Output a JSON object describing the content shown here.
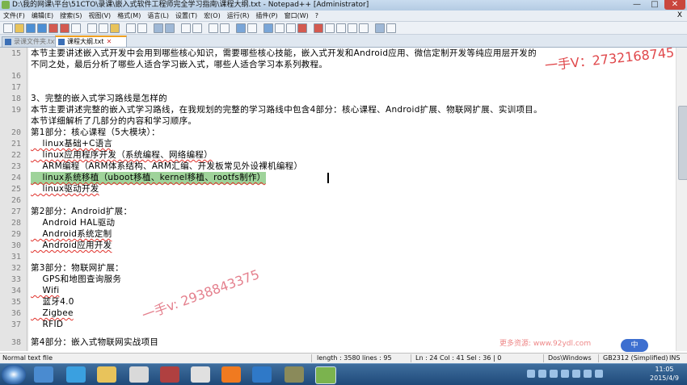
{
  "window": {
    "title": "D:\\我的网课\\平台\\51CTO\\录课\\嵌入式软件工程师完全学习指南\\课程大纲.txt - Notepad++ [Administrator]",
    "minimize_glyph": "—",
    "maximize_glyph": "□",
    "close_glyph": "✕"
  },
  "menu": [
    "文件(F)",
    "编辑(E)",
    "搜索(S)",
    "视图(V)",
    "格式(M)",
    "语言(L)",
    "设置(T)",
    "宏(O)",
    "运行(R)",
    "插件(P)",
    "窗口(W)",
    "?"
  ],
  "menu_close": "X",
  "tabs": [
    {
      "label": "录课文件夹.txt",
      "close": "✕",
      "active": false
    },
    {
      "label": "课程大纲.txt",
      "close": "✕",
      "active": true
    }
  ],
  "editor": {
    "lines": [
      {
        "n": "15",
        "text": "本节主要讲述嵌入式开发中会用到哪些核心知识，需要哪些核心技能，嵌入式开发和Android应用、微信定制开发等纯应用层开发的"
      },
      {
        "n": "",
        "text": "不同之处，最后分析了哪些人适合学习嵌入式，哪些人适合学习本系列教程。"
      },
      {
        "n": "16",
        "text": ""
      },
      {
        "n": "17",
        "text": ""
      },
      {
        "n": "18",
        "text": "3、完整的嵌入式学习路线是怎样的"
      },
      {
        "n": "19",
        "text": "本节主要讲述完整的嵌入式学习路线，在我规划的完整的学习路线中包含4部分：核心课程、Android扩展、物联网扩展、实训项目。"
      },
      {
        "n": "",
        "text": "本节详细解析了几部分的内容和学习顺序。"
      },
      {
        "n": "20",
        "text": "第1部分：核心课程（5大模块）："
      },
      {
        "n": "21",
        "text": "    linux基础+C语言"
      },
      {
        "n": "22",
        "text": "    linux应用程序开发（系统编程、网络编程）"
      },
      {
        "n": "23",
        "text": "    ARM编程（ARM体系结构、ARM汇编、开发板常见外设裸机编程）"
      },
      {
        "n": "24",
        "text": "    linux系统移植（uboot移植、kernel移植、rootfs制作）"
      },
      {
        "n": "25",
        "text": "    linux驱动开发"
      },
      {
        "n": "26",
        "text": ""
      },
      {
        "n": "27",
        "text": "第2部分：Android扩展："
      },
      {
        "n": "28",
        "text": "    Android HAL驱动"
      },
      {
        "n": "29",
        "text": "    Android系统定制"
      },
      {
        "n": "30",
        "text": "    Android应用开发"
      },
      {
        "n": "31",
        "text": ""
      },
      {
        "n": "32",
        "text": "第3部分：物联网扩展："
      },
      {
        "n": "33",
        "text": "    GPS和地图查询服务"
      },
      {
        "n": "34",
        "text": "    Wifi"
      },
      {
        "n": "35",
        "text": "    蓝牙4.0"
      },
      {
        "n": "36",
        "text": "    Zigbee"
      },
      {
        "n": "37",
        "text": "    RFID"
      },
      {
        "n": "38",
        "text": "第4部分：嵌入式物联网实战项目"
      }
    ]
  },
  "watermarks": {
    "top": "一手V：2732168745",
    "bottom": "一手v: 2938843375",
    "resource": "更多资源: www.92ydl.com"
  },
  "ime_label": "中",
  "statusbar": {
    "type": "Normal text file",
    "length": "length : 3580",
    "lines": "lines : 95",
    "position": "Ln : 24   Col : 41   Sel : 36 | 0",
    "eol": "Dos\\Windows",
    "encoding": "GB2312 (Simplified)",
    "mode": "INS"
  },
  "clock": {
    "time": "11:05",
    "date": "2015/4/9"
  }
}
